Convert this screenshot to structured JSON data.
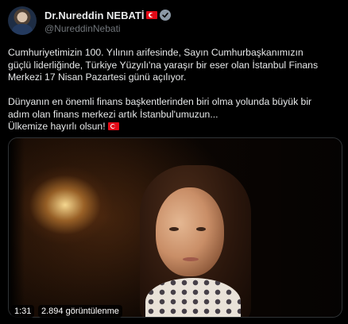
{
  "tweet": {
    "author": {
      "name": "Dr.Nureddin NEBATİ",
      "handle": "@NureddinNebati",
      "avatar_icon": "profile-photo",
      "verified_color": "#8b98a5"
    },
    "text": {
      "line1": "Cumhuriyetimizin 100. Yılının arifesinde, Sayın Cumhurbaşkanımızın",
      "line2": "güçlü liderliğinde, Türkiye Yüzyılı'na yaraşır bir eser olan İstanbul Finans",
      "line3": "Merkezi 17 Nisan Pazartesi günü açılıyor.",
      "line4": "Dünyanın en önemli finans başkentlerinden biri olma yolunda büyük bir",
      "line5": "adım olan finans merkezi artık İstanbul'umuzun...",
      "line6": "Ülkemize hayırlı olsun!"
    },
    "video": {
      "duration": "1:31",
      "views": "2.894 görüntülenme"
    },
    "colors": {
      "background": "#000000",
      "text": "#e7e9ea",
      "secondary": "#71767b",
      "flag_red": "#e30a17"
    },
    "icons": [
      "turkish-flag-icon",
      "verified-badge-icon"
    ]
  }
}
